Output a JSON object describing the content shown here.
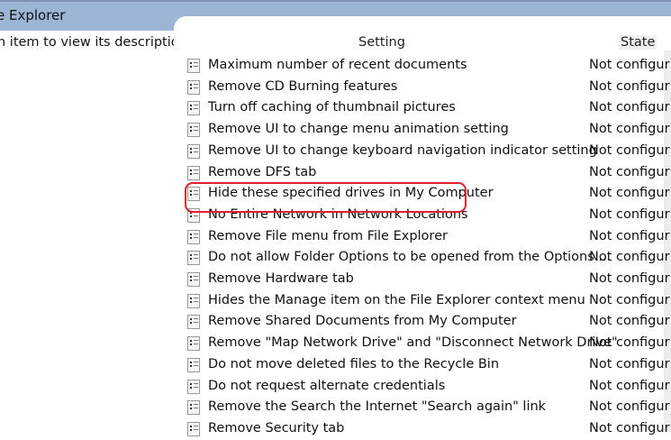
{
  "window": {
    "title": "e Explorer"
  },
  "left": {
    "description": "n item to view its description."
  },
  "columns": {
    "setting": "Setting",
    "state": "State"
  },
  "rows": [
    {
      "name": "Maximum number of recent documents",
      "state": "Not configur"
    },
    {
      "name": "Remove CD Burning features",
      "state": "Not configur"
    },
    {
      "name": "Turn off caching of thumbnail pictures",
      "state": "Not configur"
    },
    {
      "name": "Remove UI to change menu animation setting",
      "state": "Not configur"
    },
    {
      "name": "Remove UI to change keyboard navigation indicator setting",
      "state": "Not configur"
    },
    {
      "name": "Remove DFS tab",
      "state": "Not configur"
    },
    {
      "name": "Hide these specified drives in My Computer",
      "state": "Not configur"
    },
    {
      "name": "No Entire Network in Network Locations",
      "state": "Not configur"
    },
    {
      "name": "Remove File menu from File Explorer",
      "state": "Not configur"
    },
    {
      "name": "Do not allow Folder Options to be opened from the Options ...",
      "state": "Not configur"
    },
    {
      "name": "Remove Hardware tab",
      "state": "Not configur"
    },
    {
      "name": "Hides the Manage item on the File Explorer context menu",
      "state": "Not configur"
    },
    {
      "name": "Remove Shared Documents from My Computer",
      "state": "Not configur"
    },
    {
      "name": "Remove \"Map Network Drive\" and \"Disconnect Network Drive\"",
      "state": "Not configur"
    },
    {
      "name": "Do not move deleted files to the Recycle Bin",
      "state": "Not configur"
    },
    {
      "name": "Do not request alternate credentials",
      "state": "Not configur"
    },
    {
      "name": "Remove the Search the Internet \"Search again\" link",
      "state": "Not configur"
    },
    {
      "name": "Remove Security tab",
      "state": "Not configur"
    }
  ],
  "highlight_color": "#e0202a"
}
